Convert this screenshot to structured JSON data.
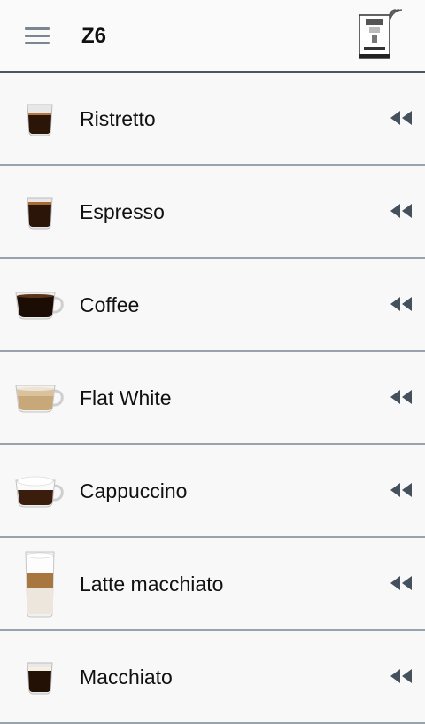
{
  "header": {
    "title": "Z6",
    "menu_icon": "hamburger-menu-icon",
    "device_icon": "coffee-machine-connected-icon"
  },
  "drinks": [
    {
      "label": "Ristretto",
      "icon": "ristretto-glass-icon"
    },
    {
      "label": "Espresso",
      "icon": "espresso-glass-icon"
    },
    {
      "label": "Coffee",
      "icon": "coffee-cup-icon"
    },
    {
      "label": "Flat White",
      "icon": "flat-white-cup-icon"
    },
    {
      "label": "Cappuccino",
      "icon": "cappuccino-cup-icon"
    },
    {
      "label": "Latte macchiato",
      "icon": "latte-macchiato-glass-icon"
    },
    {
      "label": "Macchiato",
      "icon": "macchiato-glass-icon"
    }
  ],
  "row_action_icon": "rewind-double-arrow-icon",
  "colors": {
    "divider": "#98a3ae",
    "header_divider": "#4c5560",
    "icon": "#44505c",
    "coffee_dark": "#2a1508",
    "crema": "#b5773f",
    "milk": "#efe4d2"
  }
}
